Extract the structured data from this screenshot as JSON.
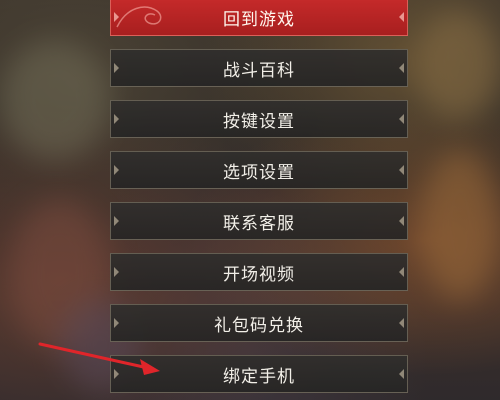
{
  "menu": {
    "items": [
      {
        "label": "回到游戏",
        "active": true
      },
      {
        "label": "战斗百科",
        "active": false
      },
      {
        "label": "按键设置",
        "active": false
      },
      {
        "label": "选项设置",
        "active": false
      },
      {
        "label": "联系客服",
        "active": false
      },
      {
        "label": "开场视频",
        "active": false
      },
      {
        "label": "礼包码兑换",
        "active": false
      },
      {
        "label": "绑定手机",
        "active": false
      }
    ]
  },
  "colors": {
    "active_item": "#c52a2a",
    "item_background": "#2e2d2b",
    "annotation_arrow": "#e0252a"
  }
}
